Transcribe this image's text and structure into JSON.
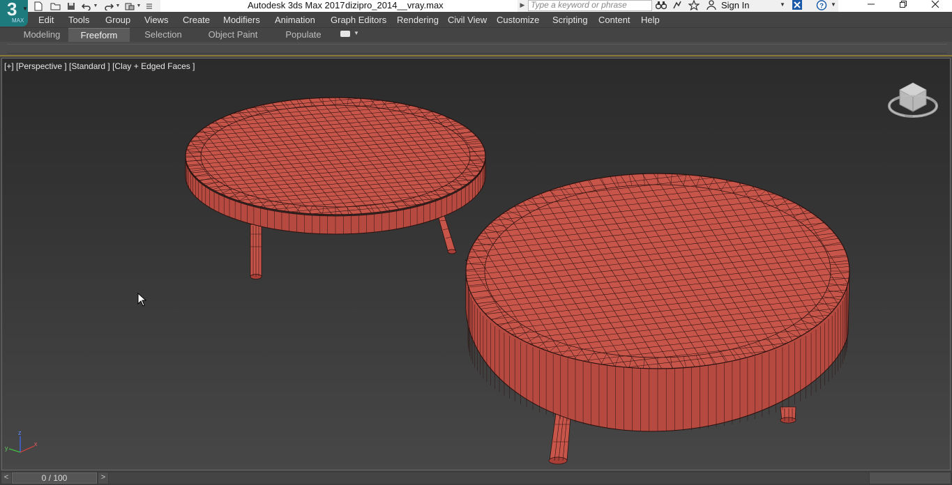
{
  "app": {
    "logo_text": "3",
    "logo_sub": "MAX",
    "title": "Autodesk 3ds Max 2017",
    "file": "dizipro_2014__vray.max"
  },
  "search": {
    "placeholder": "Type a keyword or phrase"
  },
  "account": {
    "sign_in": "Sign In"
  },
  "menu": [
    "Edit",
    "Tools",
    "Group",
    "Views",
    "Create",
    "Modifiers",
    "Animation",
    "Graph Editors",
    "Rendering",
    "Civil View",
    "Customize",
    "Scripting",
    "Content",
    "Help"
  ],
  "ribbon_tabs": [
    "Modeling",
    "Freeform",
    "Selection",
    "Object Paint",
    "Populate"
  ],
  "active_tab": "Freeform",
  "viewport": {
    "label": "[+] [Perspective ] [Standard ] [Clay + Edged Faces ]",
    "axis_z": "z",
    "axis_x": "x",
    "axis_y": "y"
  },
  "timeline": {
    "frame_display": "0 / 100",
    "prev": "<",
    "next": ">"
  },
  "colors": {
    "clay": "#c8554a",
    "clay_dark": "#a84038",
    "wire": "#2a1210",
    "viewport_top": "#2b2b2b",
    "viewport_bottom": "#474747"
  },
  "icons": [
    "app-logo-icon",
    "new-file-icon",
    "open-folder-icon",
    "save-icon",
    "undo-icon",
    "redo-icon",
    "project-icon",
    "binoculars-icon",
    "satellite-icon",
    "star-icon",
    "user-icon",
    "exchange-icon",
    "help-icon",
    "minimize-icon",
    "restore-icon",
    "close-icon",
    "viewcube-icon",
    "mouse-cursor-icon"
  ]
}
